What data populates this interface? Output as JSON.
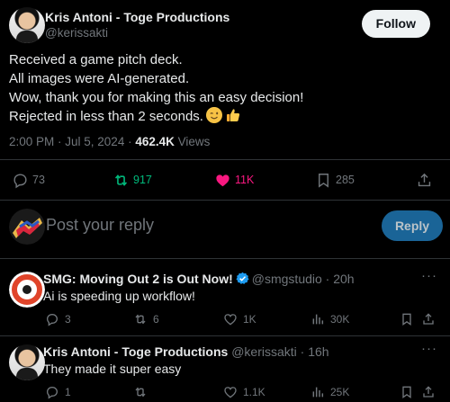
{
  "post": {
    "author": {
      "name": "Kris Antoni - Toge Productions",
      "handle": "@kerissakti"
    },
    "follow_label": "Follow",
    "text_lines": [
      "Received a game pitch deck.",
      "All images were AI-generated.",
      "Wow, thank you for making this an easy decision!",
      "Rejected in less than 2 seconds."
    ],
    "emoji_icons": [
      "winking-face-icon",
      "thumbs-up-icon"
    ],
    "time": "2:00 PM · Jul 5, 2024 · ",
    "views_count": "462.4K",
    "views_label": " Views",
    "stats": {
      "replies": "73",
      "reposts": "917",
      "likes": "11K",
      "bookmarks": "285"
    },
    "colors": {
      "repost_active": "#00ba7c",
      "like_active": "#f91880"
    }
  },
  "composer": {
    "placeholder": "Post your reply",
    "reply_label": "Reply"
  },
  "replies": [
    {
      "name": "SMG: Moving Out 2 is Out Now!",
      "verified": true,
      "handle": "@smgstudio",
      "time": " · 20h",
      "text": "Ai is speeding up workflow!",
      "stats": {
        "replies": "3",
        "reposts": "6",
        "likes": "1K",
        "views": "30K"
      }
    },
    {
      "name": "Kris Antoni - Toge Productions",
      "verified": false,
      "handle": "@kerissakti",
      "time": " · 16h",
      "text": "They made it super easy",
      "stats": {
        "replies": "1",
        "reposts": "",
        "likes": "1.1K",
        "views": "25K"
      }
    }
  ],
  "more_label": "···",
  "accent": "#1d9bf0"
}
